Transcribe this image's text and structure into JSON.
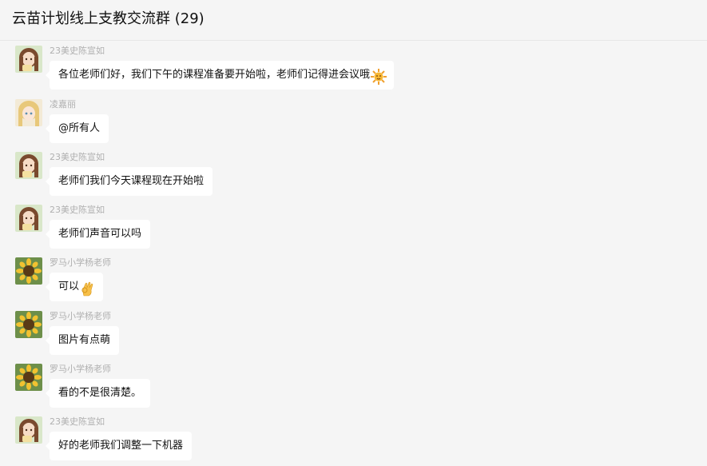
{
  "chat": {
    "title": "云苗计划线上支教交流群 (29)"
  },
  "messages": [
    {
      "sender": "23美史陈宣如",
      "avatar": "anime-girl-brown-hair-avatar",
      "text": "各位老师们好，我们下午的课程准备要开始啦，老师们记得进会议哦",
      "emoji": "sun-emoji"
    },
    {
      "sender": "凌嘉丽",
      "avatar": "anime-girl-blonde-avatar",
      "text": "@所有人",
      "emoji": ""
    },
    {
      "sender": "23美史陈宣如",
      "avatar": "anime-girl-brown-hair-avatar",
      "text": "老师们我们今天课程现在开始啦",
      "emoji": ""
    },
    {
      "sender": "23美史陈宣如",
      "avatar": "anime-girl-brown-hair-avatar",
      "text": "老师们声音可以吗",
      "emoji": ""
    },
    {
      "sender": "罗马小学杨老师",
      "avatar": "sunflower-avatar",
      "text": "可以",
      "emoji": "ok-hand-emoji"
    },
    {
      "sender": "罗马小学杨老师",
      "avatar": "sunflower-avatar",
      "text": "图片有点萌",
      "emoji": ""
    },
    {
      "sender": "罗马小学杨老师",
      "avatar": "sunflower-avatar",
      "text": "看的不是很清楚。",
      "emoji": ""
    },
    {
      "sender": "23美史陈宣如",
      "avatar": "anime-girl-brown-hair-avatar",
      "text": "好的老师我们调整一下机器",
      "emoji": ""
    }
  ],
  "colors": {
    "background": "#f5f5f5",
    "bubble": "#ffffff",
    "sender_name": "#b0b0b0"
  }
}
